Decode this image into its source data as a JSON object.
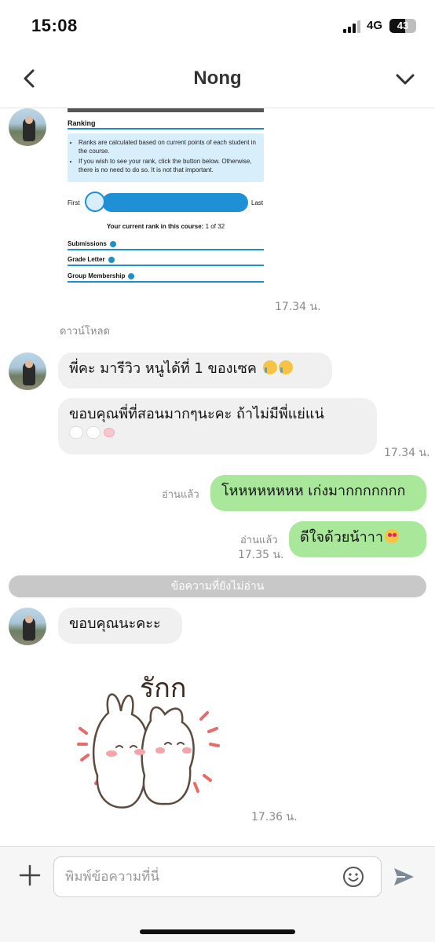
{
  "status": {
    "time": "15:08",
    "network": "4G",
    "battery": "43"
  },
  "header": {
    "title": "Nong"
  },
  "shared_image": {
    "heading": "Ranking",
    "bullets": [
      "Ranks are calculated based on current points of each student in the course.",
      "If you wish to see your rank, click the button below. Otherwise, there is no need to do so. It is not that important."
    ],
    "first_label": "First",
    "last_label": "Last",
    "current_rank_label": "Your current rank in this course:",
    "current_rank_value": "1 of 32",
    "links": [
      "Submissions",
      "Grade Letter",
      "Group Membership"
    ]
  },
  "messages": {
    "image_time": "17.34 น.",
    "download_label": "ดาวน์โหลด",
    "in1_text": "พี่คะ มารีวิว หนูได้ที่ 1 ของเซค",
    "in2_text": "ขอบคุณพี่ที่สอนมากๆนะคะ ถ้าไม่มีพี่แย่แน่",
    "in_time": "17.34 น.",
    "out1_read": "อ่านแล้ว",
    "out1_text": "โหหหหหหหห เก่งมากกกกกกก",
    "out2_read": "อ่านแล้ว",
    "out2_time": "17.35 น.",
    "out2_text": "ดีใจด้วยน้าาา",
    "unread_divider": "ข้อความที่ยังไม่อ่าน",
    "in3_text": "ขอบคุณนะคะะ",
    "sticker_text": "รักก",
    "sticker_time": "17.36 น."
  },
  "input": {
    "placeholder": "พิมพ์ข้อความที่นี่"
  }
}
